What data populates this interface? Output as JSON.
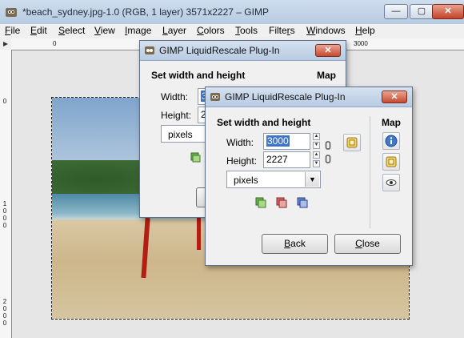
{
  "window": {
    "title": "*beach_sydney.jpg-1.0 (RGB, 1 layer) 3571x2227 – GIMP",
    "controls": {
      "minimize": "—",
      "maximize": "▢",
      "close": "✕"
    }
  },
  "menu": [
    {
      "pre": "",
      "mn": "F",
      "post": "ile"
    },
    {
      "pre": "",
      "mn": "E",
      "post": "dit"
    },
    {
      "pre": "",
      "mn": "S",
      "post": "elect"
    },
    {
      "pre": "",
      "mn": "V",
      "post": "iew"
    },
    {
      "pre": "",
      "mn": "I",
      "post": "mage"
    },
    {
      "pre": "",
      "mn": "L",
      "post": "ayer"
    },
    {
      "pre": "",
      "mn": "C",
      "post": "olors"
    },
    {
      "pre": "",
      "mn": "T",
      "post": "ools"
    },
    {
      "pre": "Filte",
      "mn": "r",
      "post": "s"
    },
    {
      "pre": "",
      "mn": "W",
      "post": "indows"
    },
    {
      "pre": "",
      "mn": "H",
      "post": "elp"
    }
  ],
  "ruler": {
    "top_marks": [
      "0",
      "3000"
    ],
    "left_marks": [
      "0",
      "1000",
      "2000"
    ]
  },
  "dialog_back": {
    "title": "GIMP LiquidRescale Plug-In",
    "close": "✕",
    "section": "Set width and height",
    "map_head": "Map",
    "width_label": "Width:",
    "width_value": "3",
    "height_label": "Height:",
    "height_value": "22",
    "units": "pixels"
  },
  "dialog_front": {
    "title": "GIMP LiquidRescale Plug-In",
    "close": "✕",
    "section": "Set width and height",
    "map_head": "Map",
    "width_label": "Width:",
    "width_value": "3000",
    "height_label": "Height:",
    "height_value": "2227",
    "units": "pixels",
    "back_mn": "B",
    "back_rest": "ack",
    "close_mn": "C",
    "close_rest": "lose",
    "icons": [
      "green-layer-icon",
      "red-layer-icon",
      "blue-layer-icon",
      "info-icon",
      "layer-icon",
      "eye-icon",
      "link-icon"
    ]
  },
  "colors": {
    "selection": "#3b74c9",
    "titlebar": "#b7cbe2",
    "close": "#c44a2f"
  }
}
